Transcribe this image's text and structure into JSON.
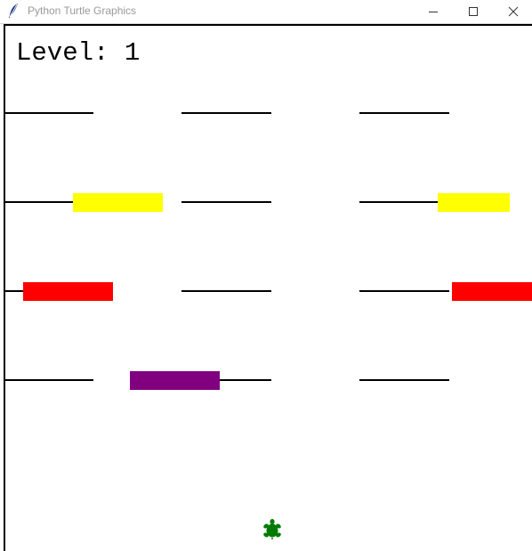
{
  "window": {
    "title": "Python Turtle Graphics",
    "icons": {
      "app": "feather-icon",
      "minimize": "minimize-icon",
      "maximize": "maximize-icon",
      "close": "close-icon"
    }
  },
  "game": {
    "level_prefix": "Level:",
    "level_value": "1",
    "player": {
      "shape": "turtle",
      "color": "#007a00"
    },
    "car_colors": {
      "yellow": "#ffff00",
      "red": "#ff0000",
      "purple": "#800080"
    },
    "lane_color": "#000000"
  }
}
